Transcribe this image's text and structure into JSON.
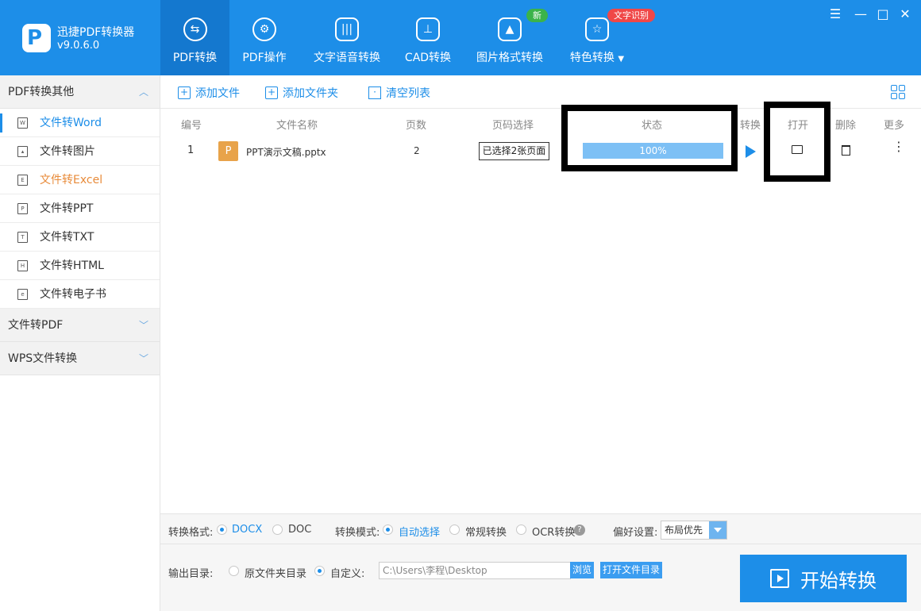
{
  "app": {
    "name": "迅捷PDF转换器",
    "version": "v9.0.6.0"
  },
  "nav": [
    {
      "label": "PDF转换",
      "icon": "pdf-convert-icon"
    },
    {
      "label": "PDF操作",
      "icon": "gear-icon"
    },
    {
      "label": "文字语音转换",
      "icon": "audio-wave-icon"
    },
    {
      "label": "CAD转换",
      "icon": "cad-icon"
    },
    {
      "label": "图片格式转换",
      "icon": "image-icon"
    },
    {
      "label": "特色转换",
      "icon": "star-icon"
    }
  ],
  "badges": {
    "new": "新",
    "ocr": "文字识别"
  },
  "sidebar": {
    "group1": "PDF转换其他",
    "items": [
      "文件转Word",
      "文件转图片",
      "文件转Excel",
      "文件转PPT",
      "文件转TXT",
      "文件转HTML",
      "文件转电子书"
    ],
    "group2": "文件转PDF",
    "group3": "WPS文件转换"
  },
  "toolbar": {
    "add_file": "添加文件",
    "add_folder": "添加文件夹",
    "clear": "清空列表"
  },
  "table": {
    "headers": [
      "编号",
      "文件名称",
      "页数",
      "页码选择",
      "状态",
      "转换",
      "打开",
      "删除",
      "更多"
    ],
    "rows": [
      {
        "index": "1",
        "file_icon": "P",
        "name": "PPT演示文稿.pptx",
        "pages": "2",
        "page_select": "已选择2张页面",
        "progress_label": "100%",
        "progress": 1.0
      }
    ]
  },
  "options": {
    "format_label": "转换格式:",
    "format_docx": "DOCX",
    "format_doc": "DOC",
    "mode_label": "转换模式:",
    "mode_auto": "自动选择",
    "mode_normal": "常规转换",
    "mode_ocr": "OCR转换",
    "pref_label": "偏好设置:",
    "pref_value": "布局优先"
  },
  "output": {
    "label": "输出目录:",
    "original": "原文件夹目录",
    "custom": "自定义:",
    "path": "C:\\Users\\李程\\Desktop",
    "browse": "浏览",
    "open_dir": "打开文件目录"
  },
  "start_button": "开始转换",
  "colors": {
    "primary": "#1d8ee8",
    "nav_active": "#1478cf",
    "badge_new": "#3bb34a",
    "badge_ocr": "#f04747",
    "highlight": "#e88b3a"
  }
}
